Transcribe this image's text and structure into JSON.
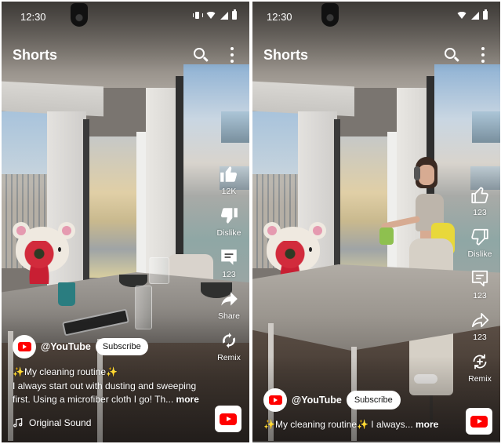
{
  "screens": [
    {
      "status_bar": {
        "time": "12:30",
        "icons": [
          "vibrate-icon",
          "wifi-icon",
          "cellular-signal-icon",
          "battery-icon"
        ]
      },
      "header": {
        "title": "Shorts",
        "search_icon": "search-icon",
        "more_icon": "more-vert-icon"
      },
      "actions": {
        "like": {
          "icon": "thumb-up-filled-icon",
          "label": "12K"
        },
        "dislike": {
          "icon": "thumb-down-filled-icon",
          "label": "Dislike"
        },
        "comments": {
          "icon": "comment-filled-icon",
          "label": "123"
        },
        "share": {
          "icon": "share-filled-icon",
          "label": "Share"
        },
        "remix": {
          "icon": "remix-filled-icon",
          "label": "Remix"
        }
      },
      "channel": {
        "handle": "@YouTube",
        "subscribe_label": "Subscribe"
      },
      "description": {
        "title_sparkle_left": "✨",
        "title": "My cleaning routine",
        "title_sparkle_right": "✨",
        "text": "I always start out with dusting and sweeping first. Using a microfiber cloth I go! Th...",
        "more_label": "more"
      },
      "sound": {
        "icon": "music-note-icon",
        "label": "Original Sound"
      },
      "app_button": {
        "icon": "youtube-logo-icon"
      }
    },
    {
      "status_bar": {
        "time": "12:30",
        "icons": [
          "wifi-icon",
          "cellular-signal-icon",
          "battery-icon"
        ]
      },
      "header": {
        "title": "Shorts",
        "search_icon": "search-icon",
        "more_icon": "more-vert-icon"
      },
      "actions": {
        "like": {
          "icon": "thumb-up-outline-icon",
          "label": "123"
        },
        "dislike": {
          "icon": "thumb-down-outline-icon",
          "label": "Dislike"
        },
        "comments": {
          "icon": "comment-outline-icon",
          "label": "123"
        },
        "share": {
          "icon": "share-outline-icon",
          "label": "123"
        },
        "remix": {
          "icon": "remix-outline-icon",
          "label": "Remix"
        }
      },
      "channel": {
        "handle": "@YouTube",
        "subscribe_label": "Subscribe"
      },
      "description": {
        "title_sparkle_left": "✨",
        "title": "My cleaning routine",
        "title_sparkle_right": "✨",
        "text": " I always...",
        "more_label": "more"
      },
      "app_button": {
        "icon": "youtube-logo-icon"
      }
    }
  ],
  "colors": {
    "brand_red": "#ff0000",
    "text_on_video": "#ffffff",
    "subscribe_bg": "#ffffff",
    "sparkle": "#f7d44a"
  }
}
